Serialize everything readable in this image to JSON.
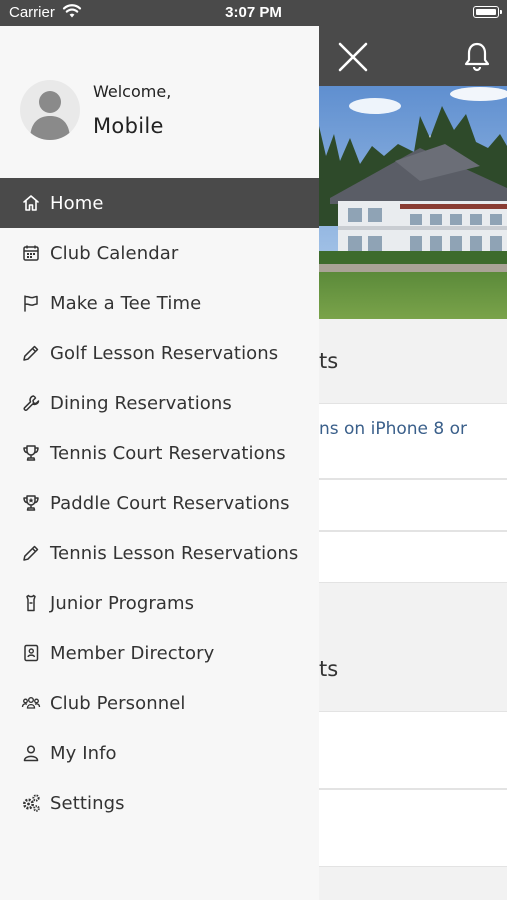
{
  "status_bar": {
    "carrier": "Carrier",
    "time": "3:07 PM"
  },
  "drawer": {
    "welcome": "Welcome,",
    "user_name": "Mobile",
    "items": [
      {
        "label": "Home",
        "icon": "home-icon",
        "active": true
      },
      {
        "label": "Club Calendar",
        "icon": "calendar-icon"
      },
      {
        "label": "Make a Tee Time",
        "icon": "flag-icon"
      },
      {
        "label": "Golf Lesson Reservations",
        "icon": "pencil-icon"
      },
      {
        "label": "Dining Reservations",
        "icon": "wrench-icon"
      },
      {
        "label": "Tennis Court Reservations",
        "icon": "trophy-icon"
      },
      {
        "label": "Paddle Court Reservations",
        "icon": "trophy-badge-icon"
      },
      {
        "label": "Tennis Lesson Reservations",
        "icon": "pencil-icon"
      },
      {
        "label": "Junior Programs",
        "icon": "shirt-icon"
      },
      {
        "label": "Member Directory",
        "icon": "contact-book-icon"
      },
      {
        "label": "Club Personnel",
        "icon": "group-icon"
      },
      {
        "label": "My Info",
        "icon": "user-icon"
      },
      {
        "label": "Settings",
        "icon": "gears-icon"
      }
    ]
  },
  "background": {
    "section1_title_fragment": "ts",
    "link_fragment": "ns on iPhone 8 or",
    "section2_title_fragment": "ts"
  },
  "colors": {
    "header": "#4a4a4a",
    "drawer": "#f7f7f7",
    "link": "#3a5f8a",
    "active_item": "#4a4a4a"
  }
}
